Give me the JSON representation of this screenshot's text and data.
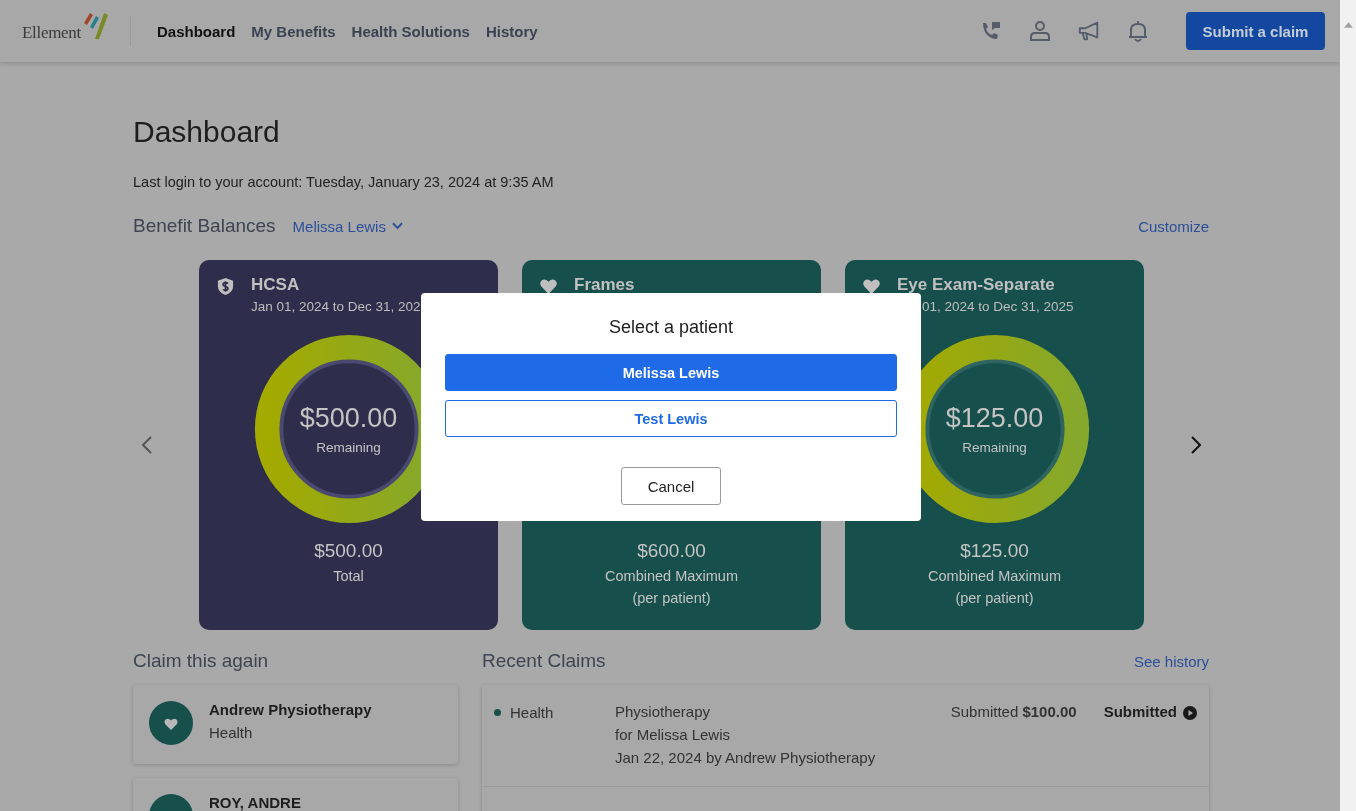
{
  "header": {
    "logo": "Ellement",
    "nav": [
      {
        "label": "Dashboard",
        "selected": true
      },
      {
        "label": "My Benefits",
        "selected": false
      },
      {
        "label": "Health Solutions",
        "selected": false
      },
      {
        "label": "History",
        "selected": false
      }
    ],
    "submit_button": "Submit a claim"
  },
  "page": {
    "title": "Dashboard",
    "last_login": "Last login to your account: Tuesday, January 23, 2024 at 9:35 AM",
    "balances": {
      "title": "Benefit Balances",
      "patient": "Melissa Lewis",
      "customize": "Customize",
      "cards": [
        {
          "kind": "shield",
          "title": "HCSA",
          "dates": "Jan 01, 2024 to Dec 31, 202",
          "amount": "$500.00",
          "amount_label": "Remaining",
          "total": "$500.00",
          "total_label": "Total"
        },
        {
          "kind": "heart",
          "title": "Frames",
          "total": "$600.00",
          "total_label": "Combined Maximum",
          "total_note": "(per patient)"
        },
        {
          "kind": "heart",
          "title": "Eye Exam-Separate",
          "dates": "01, 2024 to Dec 31, 2025",
          "amount": "$125.00",
          "amount_label": "Remaining",
          "total": "$125.00",
          "total_label": "Combined Maximum",
          "total_note": "(per patient)"
        }
      ]
    },
    "claim_again": {
      "title": "Claim this again",
      "items": [
        {
          "name": "Andrew Physiotherapy",
          "category": "Health"
        },
        {
          "name": "ROY, ANDRE"
        }
      ]
    },
    "recent_claims": {
      "title": "Recent Claims",
      "link": "See history",
      "rows": [
        {
          "category": "Health",
          "color": "#17504b",
          "service": "Physiotherapy",
          "patient": "for Melissa Lewis",
          "date": "Jan 22, 2024 by Andrew Physiotherapy",
          "amount": "Submitted **$100.00**",
          "status": "Submitted"
        }
      ]
    }
  },
  "modal": {
    "title": "Select a patient",
    "options": [
      {
        "label": "Melissa Lewis",
        "selected": true
      },
      {
        "label": "Test Lewis",
        "selected": false
      }
    ],
    "cancel": "Cancel"
  }
}
